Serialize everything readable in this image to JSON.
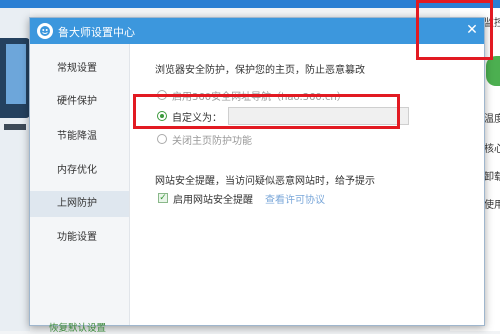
{
  "background": {
    "right_labels": [
      "监控",
      "温度",
      "核心",
      "卸载",
      "使用"
    ]
  },
  "dialog": {
    "title": "鲁大师设置中心",
    "close_symbol": "✕",
    "sidebar": {
      "items": [
        {
          "label": "常规设置"
        },
        {
          "label": "硬件保护"
        },
        {
          "label": "节能降温"
        },
        {
          "label": "内存优化"
        },
        {
          "label": "上网防护"
        },
        {
          "label": "功能设置"
        }
      ],
      "active_index": 4,
      "restore_label": "恢复默认设置"
    },
    "homepage": {
      "heading": "浏览器安全防护，保护您的主页，防止恶意篡改",
      "option_360": "启用360安全网址导航（hao.360.cn）",
      "option_custom": "自定义为：",
      "custom_value": "",
      "option_disable": "关闭主页防护功能",
      "selected": "custom"
    },
    "site_alert": {
      "heading": "网站安全提醒，当访问疑似恶意网站时，给予提示",
      "checkbox_label": "启用网站安全提醒",
      "checked": true,
      "agreement_link": "查看许可协议"
    }
  },
  "colors": {
    "titlebar": "#3c97dd",
    "annotation": "#e21a22",
    "accent_green": "#3c9a3c"
  }
}
